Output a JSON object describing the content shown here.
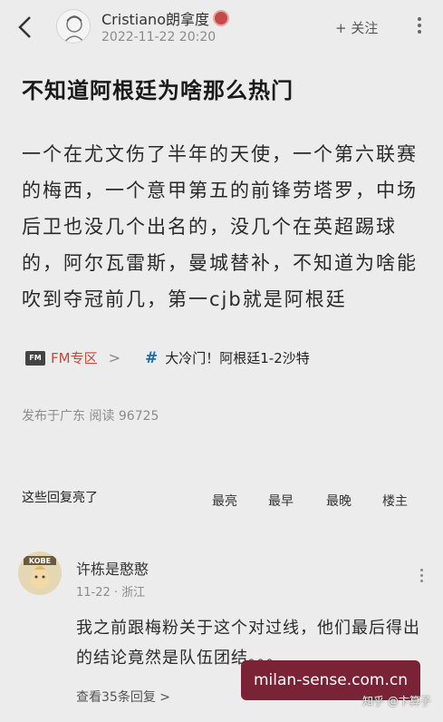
{
  "header": {
    "username": "Cristiano朗拿度",
    "timestamp": "2022-11-22 20:20",
    "follow_label": "+ 关注"
  },
  "post": {
    "title": "不知道阿根廷为啥那么热门",
    "body": "一个在尤文伤了半年的天使，一个第六联赛的梅西，一个意甲第五的前锋劳塔罗，中场后卫也没几个出名的，没几个在英超踢球的，阿尔瓦雷斯，曼城替补，不知道为啥能吹到夺冠前几，第一cjb就是阿根廷"
  },
  "tags": {
    "fm_icon_text": "FM",
    "fm_label": "FM专区",
    "fm_chevron": ">",
    "topic_label": "大冷门！阿根廷1-2沙特"
  },
  "publish_info": "发布于广东  阅读 96725",
  "replies_section": {
    "label": "这些回复亮了",
    "sort_options": [
      "最亮",
      "最早",
      "最晚",
      "楼主"
    ]
  },
  "comment": {
    "avatar_text": "KOBE",
    "author": "许栋是憨憨",
    "meta": "11-22 · 浙江",
    "text": "我之前跟梅粉关于这个对过线，他们最后得出的结论竟然是队伍团结。。。",
    "replies_link": "查看35条回复 >"
  },
  "watermarks": {
    "site": "milan-sense.com.cn",
    "platform": "知乎 @卞算子"
  },
  "colors": {
    "background": "#ececec",
    "accent_red": "#c14b3b",
    "topic_blue": "#1a6fb3",
    "watermark_bg": "#7a2336"
  }
}
